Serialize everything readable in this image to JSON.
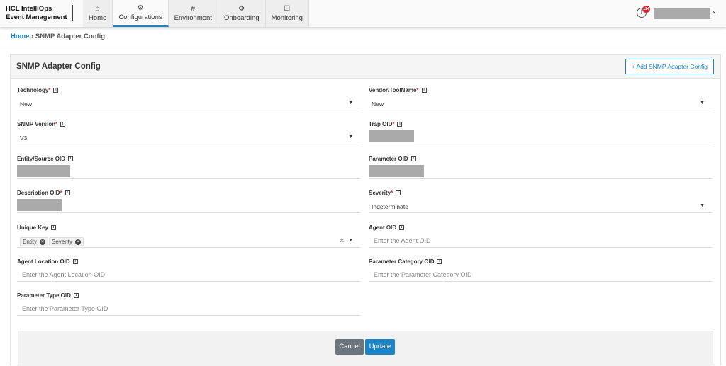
{
  "app": {
    "brand_line1": "HCL IntelliOps",
    "brand_line2": "Event Management",
    "notification_count": "114"
  },
  "nav": [
    {
      "label": "Home",
      "icon": "⌂"
    },
    {
      "label": "Configurations",
      "icon": "⚙"
    },
    {
      "label": "Environment",
      "icon": "#"
    },
    {
      "label": "Onboarding",
      "icon": "⚙"
    },
    {
      "label": "Monitoring",
      "icon": "☐"
    }
  ],
  "breadcrumb": {
    "home": "Home",
    "sep": "›",
    "current": "SNMP Adapter Config"
  },
  "card": {
    "title": "SNMP Adapter Config",
    "add_button": "+ Add SNMP Adapter Config"
  },
  "fields": {
    "technology": {
      "label": "Technology",
      "value": "New"
    },
    "vendor": {
      "label": "Vendor/ToolName",
      "value": "New"
    },
    "snmp_version": {
      "label": "SNMP Version",
      "value": "V3"
    },
    "trap_oid": {
      "label": "Trap OID"
    },
    "entity_oid": {
      "label": "Entity/Source OID"
    },
    "parameter_oid": {
      "label": "Parameter OID"
    },
    "description_oid": {
      "label": "Description OID"
    },
    "severity": {
      "label": "Severity",
      "value": "Indeterminate"
    },
    "unique_key": {
      "label": "Unique Key",
      "chips": [
        "Entity",
        "Severity"
      ]
    },
    "agent_oid": {
      "label": "Agent OID",
      "placeholder": "Enter the Agent OID"
    },
    "agent_location_oid": {
      "label": "Agent Location OID",
      "placeholder": "Enter the Agent Location OID"
    },
    "parameter_category_oid": {
      "label": "Parameter Category OID",
      "placeholder": "Enter the Parameter Category OID"
    },
    "parameter_type_oid": {
      "label": "Parameter Type OID",
      "placeholder": "Enter the Parameter Type OID"
    }
  },
  "footer": {
    "cancel": "Cancel",
    "update": "Update"
  }
}
